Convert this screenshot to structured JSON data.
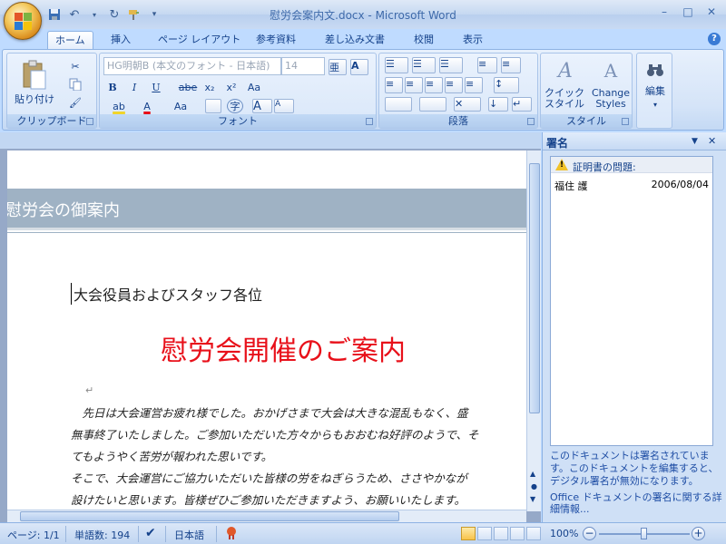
{
  "window": {
    "title": "慰労会案内文.docx - Microsoft Word",
    "minimize": "–",
    "maximize": "□",
    "close": "✕"
  },
  "qat": {
    "customize": "▾"
  },
  "tabs": [
    "ホーム",
    "挿入",
    "ページ レイアウト",
    "参考資料",
    "差し込み文書",
    "校閲",
    "表示"
  ],
  "active_tab": "ホーム",
  "help": "?",
  "ribbon": {
    "clipboard": {
      "paste": "貼り付け",
      "label": "クリップボード"
    },
    "font": {
      "name": "HG明朝B (本文のフォント - 日本語)",
      "size": "14",
      "label": "フォント",
      "bold": "B",
      "italic": "I",
      "underline": "U",
      "strike": "abe",
      "sub": "x₂",
      "sup": "x²",
      "grow": "A",
      "shrink": "A",
      "clear": "Aa",
      "phonetic": "亜",
      "enclosed": "字",
      "highlight": "ab",
      "fontcolor": "A",
      "charscale": "Aa",
      "charborder": "A"
    },
    "paragraph": {
      "label": "段落"
    },
    "styles": {
      "quick": "クイック\nスタイル",
      "change": "Change\nStyles",
      "label": "スタイル"
    },
    "editing": {
      "label": "編集"
    }
  },
  "document": {
    "banner": "慰労会の御案内",
    "addressee": "大会役員およびスタッフ各位",
    "heading": "慰労会開催のご案内",
    "para_mark": "↵",
    "body_lines": [
      "　先日は大会運営お疲れ様でした。おかげさまで大会は大きな混乱もなく、盛",
      "無事終了いたしました。ご参加いただいた方々からもおおむね好評のようで、そ",
      "てもようやく苦労が報われた思いです。",
      "そこで、大会運営にご協力いただいた皆様の労をねぎらうため、ささやかなが",
      "設けたいと思います。皆様ぜひご参加いただきますよう、お願いいたします。"
    ]
  },
  "signature_pane": {
    "title": "署名",
    "menu": "▼",
    "close": "✕",
    "warning": "証明書の問題:",
    "signer": "福住 護",
    "date": "2006/08/04",
    "message": "このドキュメントは署名されています。このドキュメントを編集すると、デジタル署名が無効になります。",
    "link": "Office ドキュメントの署名に関する詳細情報..."
  },
  "status": {
    "page": "ページ: 1/1",
    "words": "単語数: 194",
    "language": "日本語",
    "zoom": "100%",
    "zoom_minus": "−",
    "zoom_plus": "+",
    "zoom_level": 0.5
  },
  "colors": {
    "heading": "#e8101a",
    "banner": "#9fb2c4",
    "accent": "#15428b"
  }
}
